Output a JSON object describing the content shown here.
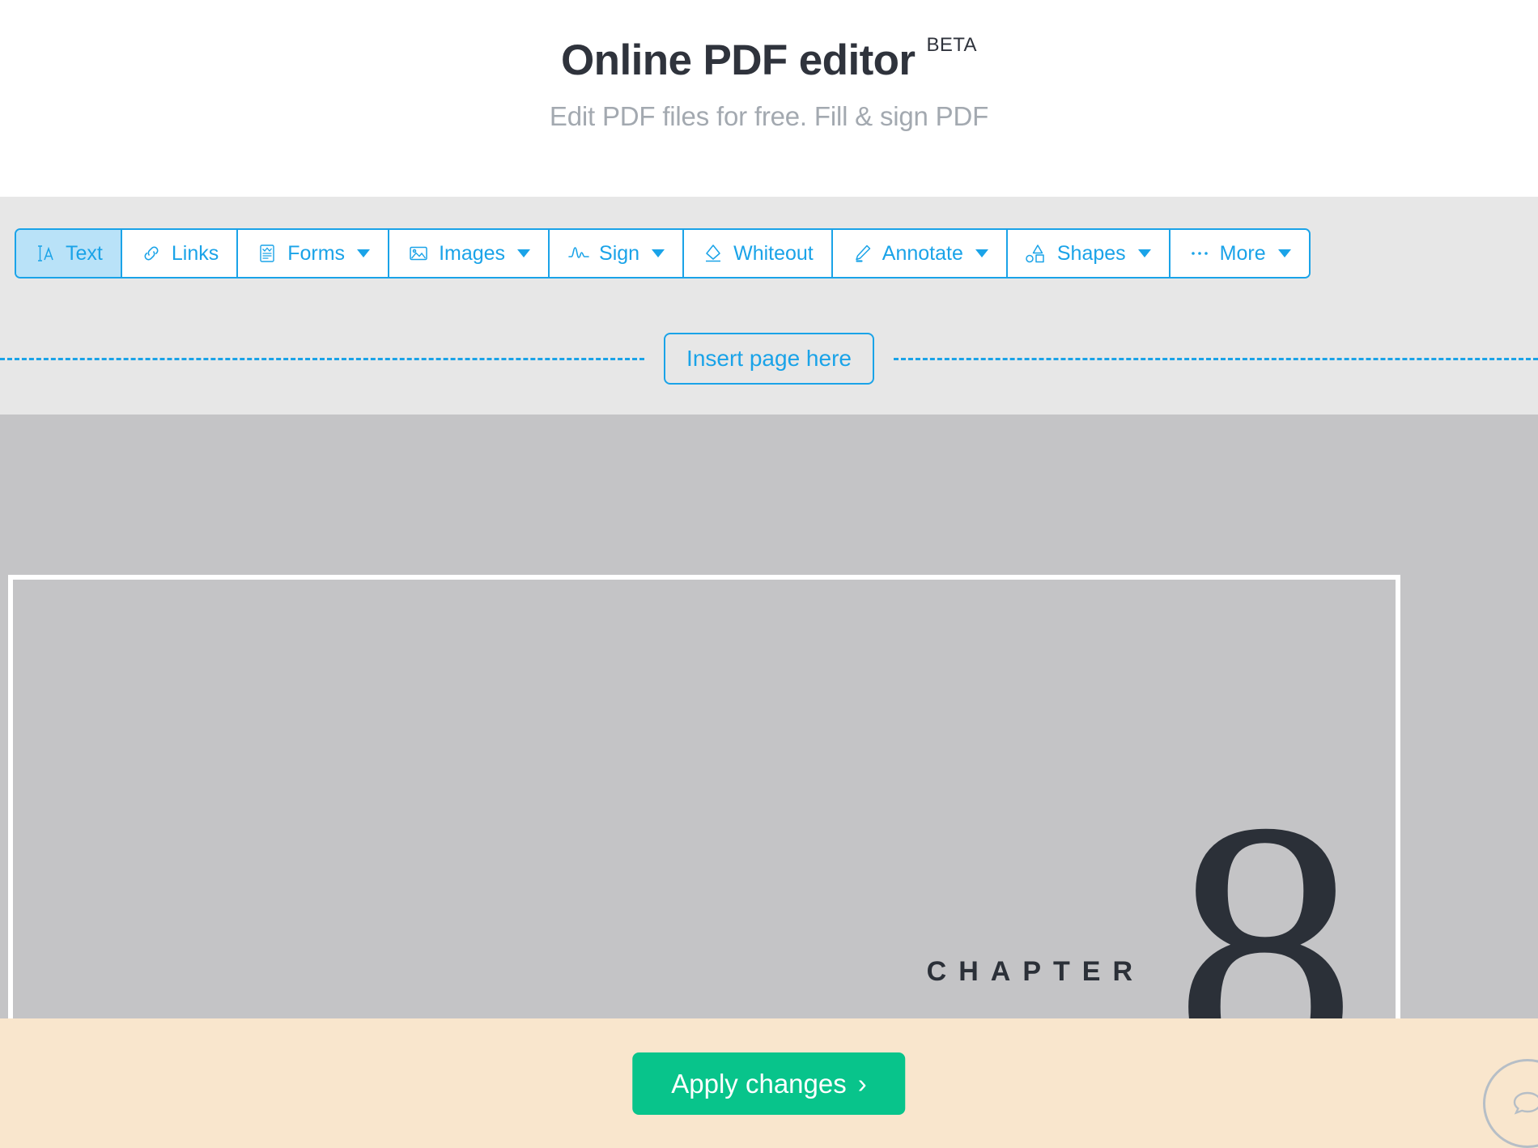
{
  "header": {
    "title": "Online PDF editor",
    "badge": "BETA",
    "subtitle": "Edit PDF files for free. Fill & sign PDF"
  },
  "toolbar": {
    "buttons": [
      {
        "label": "Text",
        "icon": "text-cursor-icon",
        "caret": false,
        "active": true
      },
      {
        "label": "Links",
        "icon": "link-icon",
        "caret": false,
        "active": false
      },
      {
        "label": "Forms",
        "icon": "form-icon",
        "caret": true,
        "active": false
      },
      {
        "label": "Images",
        "icon": "image-icon",
        "caret": true,
        "active": false
      },
      {
        "label": "Sign",
        "icon": "signature-icon",
        "caret": true,
        "active": false
      },
      {
        "label": "Whiteout",
        "icon": "eraser-icon",
        "caret": false,
        "active": false
      },
      {
        "label": "Annotate",
        "icon": "highlighter-icon",
        "caret": true,
        "active": false
      },
      {
        "label": "Shapes",
        "icon": "shapes-icon",
        "caret": true,
        "active": false
      },
      {
        "label": "More",
        "icon": "ellipsis-icon",
        "caret": true,
        "active": false
      }
    ]
  },
  "insert_page": {
    "label": "Insert page here"
  },
  "document": {
    "chapter_label": "CHAPTER",
    "chapter_number": "8"
  },
  "footer": {
    "apply_label": "Apply changes",
    "apply_chevron": "›",
    "chat_icon": "chat-bubble-icon"
  },
  "colors": {
    "accent_blue": "#1aa3e8",
    "active_blue_bg": "#b9e2f8",
    "title_dark": "#2f333c",
    "subtitle_gray": "#a3a9b0",
    "toolbar_bg": "#e7e7e7",
    "doc_bg": "#c4c4c6",
    "footer_bg": "#f9e6cd",
    "apply_green": "#08c48b"
  }
}
